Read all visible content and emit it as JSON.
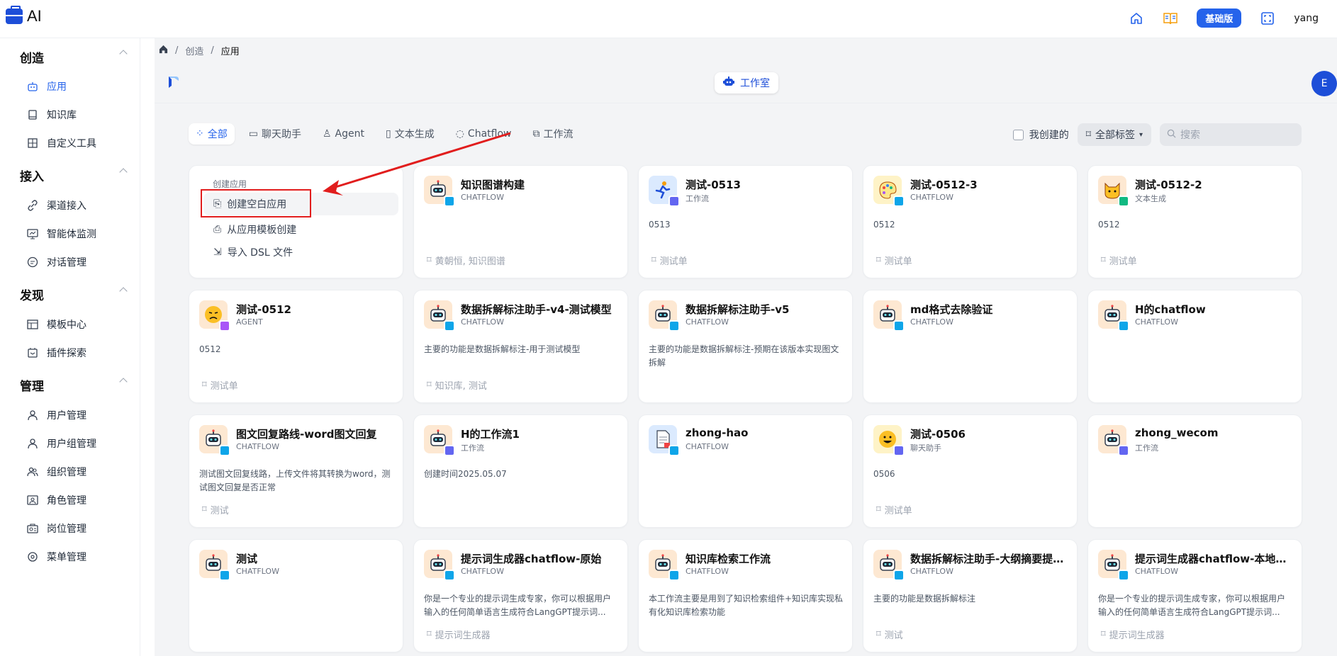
{
  "header": {
    "app_name": "AI",
    "plan_label": "基础版",
    "username": "yang",
    "icons": [
      "home-icon",
      "book-icon",
      "fullscreen-icon"
    ]
  },
  "sidebar": {
    "sections": [
      {
        "title": "创造",
        "items": [
          {
            "label": "应用",
            "icon": "robot-icon",
            "active": true
          },
          {
            "label": "知识库",
            "icon": "book-icon"
          },
          {
            "label": "自定义工具",
            "icon": "tool-icon"
          }
        ]
      },
      {
        "title": "接入",
        "items": [
          {
            "label": "渠道接入",
            "icon": "link-icon"
          },
          {
            "label": "智能体监测",
            "icon": "monitor-icon"
          },
          {
            "label": "对话管理",
            "icon": "chat-icon"
          }
        ]
      },
      {
        "title": "发现",
        "items": [
          {
            "label": "模板中心",
            "icon": "template-icon"
          },
          {
            "label": "插件探索",
            "icon": "plugin-icon"
          }
        ]
      },
      {
        "title": "管理",
        "items": [
          {
            "label": "用户管理",
            "icon": "user-icon"
          },
          {
            "label": "用户组管理",
            "icon": "user-group-icon"
          },
          {
            "label": "组织管理",
            "icon": "org-icon"
          },
          {
            "label": "角色管理",
            "icon": "role-icon"
          },
          {
            "label": "岗位管理",
            "icon": "post-icon"
          },
          {
            "label": "菜单管理",
            "icon": "menu-icon"
          }
        ]
      }
    ]
  },
  "breadcrumb": [
    "创造",
    "应用"
  ],
  "studio_label": "工作室",
  "avatar_letter": "E",
  "tabs": [
    "全部",
    "聊天助手",
    "Agent",
    "文本生成",
    "Chatflow",
    "工作流"
  ],
  "filters": {
    "mine_label": "我创建的",
    "tags_label": "全部标签",
    "search_placeholder": "搜索"
  },
  "create": {
    "label": "创建应用",
    "options": [
      "创建空白应用",
      "从应用模板创建",
      "导入 DSL 文件"
    ]
  },
  "cards": [
    {
      "title": "知识图谱构建",
      "type": "CHATFLOW",
      "desc": "",
      "tags": "黄朝恒, 知识图谱",
      "avatar": "robot"
    },
    {
      "title": "测试-0513",
      "type": "工作流",
      "desc": "0513",
      "tags": "测试单",
      "avatar": "runner"
    },
    {
      "title": "测试-0512-3",
      "type": "CHATFLOW",
      "desc": "0512",
      "tags": "测试单",
      "avatar": "palette"
    },
    {
      "title": "测试-0512-2",
      "type": "文本生成",
      "desc": "0512",
      "tags": "测试单",
      "avatar": "cat"
    },
    {
      "title": "测试-0512",
      "type": "AGENT",
      "desc": "0512",
      "tags": "测试单",
      "avatar": "face"
    },
    {
      "title": "数据拆解标注助手-v4-测试模型",
      "type": "CHATFLOW",
      "desc": "主要的功能是数据拆解标注-用于测试模型",
      "tags": "知识库, 测试",
      "avatar": "robot"
    },
    {
      "title": "数据拆解标注助手-v5",
      "type": "CHATFLOW",
      "desc": "主要的功能是数据拆解标注-预期在该版本实现图文拆解",
      "tags": "",
      "avatar": "robot"
    },
    {
      "title": "md格式去除验证",
      "type": "CHATFLOW",
      "desc": "",
      "tags": "",
      "avatar": "robot"
    },
    {
      "title": "H的chatflow",
      "type": "CHATFLOW",
      "desc": "",
      "tags": "",
      "avatar": "robot"
    },
    {
      "title": "图文回复路线-word图文回复",
      "type": "CHATFLOW",
      "desc": "测试图文回复线路，上传文件将其转换为word，测试图文回复是否正常",
      "tags": "测试",
      "avatar": "robot"
    },
    {
      "title": "H的工作流1",
      "type": "工作流",
      "desc": "创建时间2025.05.07",
      "tags": "",
      "avatar": "robot"
    },
    {
      "title": "zhong-hao",
      "type": "CHATFLOW",
      "desc": "",
      "tags": "",
      "avatar": "doc"
    },
    {
      "title": "测试-0506",
      "type": "聊天助手",
      "desc": "0506",
      "tags": "测试单",
      "avatar": "smile"
    },
    {
      "title": "zhong_wecom",
      "type": "工作流",
      "desc": "",
      "tags": "",
      "avatar": "robot"
    },
    {
      "title": "测试",
      "type": "CHATFLOW",
      "desc": "",
      "tags": "",
      "avatar": "robot"
    },
    {
      "title": "提示词生成器chatflow-原始",
      "type": "CHATFLOW",
      "desc": "你是一个专业的提示词生成专家，你可以根据用户输入的任何简单语言生成符合LangGPT提示词...",
      "tags": "提示词生成器",
      "avatar": "robot"
    },
    {
      "title": "知识库检索工作流",
      "type": "CHATFLOW",
      "desc": "本工作流主要是用到了知识检索组件+知识库实现私有化知识库检索功能",
      "tags": "",
      "avatar": "robot"
    },
    {
      "title": "数据拆解标注助手-大纲摘要提示...",
      "type": "CHATFLOW",
      "desc": "主要的功能是数据拆解标注",
      "tags": "测试",
      "avatar": "robot"
    },
    {
      "title": "提示词生成器chatflow-本地模型",
      "type": "CHATFLOW",
      "desc": "你是一个专业的提示词生成专家，你可以根据用户输入的任何简单语言生成符合LangGPT提示词...",
      "tags": "提示词生成器",
      "avatar": "robot"
    }
  ],
  "colors": {
    "accent": "#2563eb",
    "annotation": "#e11d1d",
    "bg": "#f3f4f6"
  }
}
